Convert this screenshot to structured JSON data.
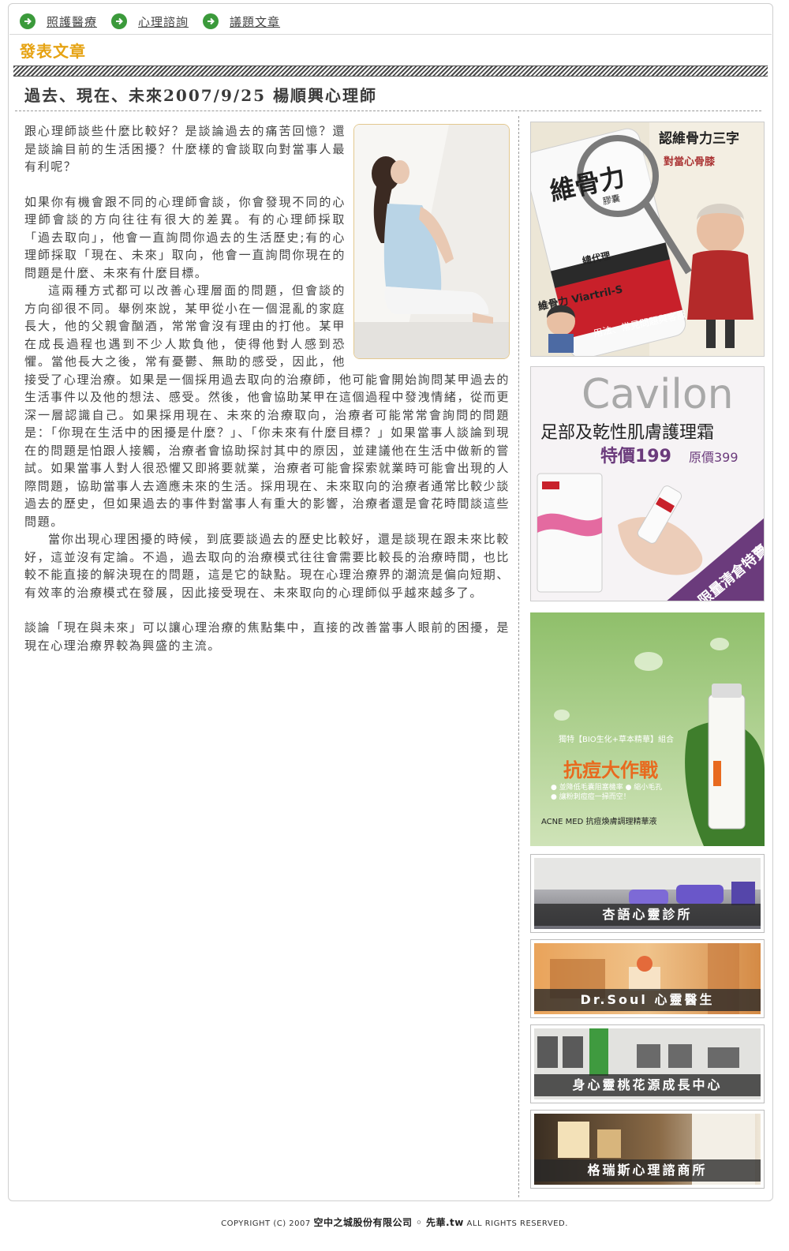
{
  "nav": {
    "items": [
      {
        "label": "照護醫療"
      },
      {
        "label": "心理諮詢"
      },
      {
        "label": "議題文章"
      }
    ]
  },
  "section": {
    "title": "發表文章"
  },
  "article": {
    "title": "過去、現在、未來2007/9/25  楊順興心理師",
    "paragraphs": [
      "跟心理師談些什麼比較好？是談論過去的痛苦回憶？還是談論目前的生活困擾？什麼樣的會談取向對當事人最有利呢？",
      "如果你有機會跟不同的心理師會談，你會發現不同的心理師會談的方向往往有很大的差異。有的心理師採取「過去取向」，他會一直詢問你過去的生活歷史;有的心理師採取「現在、未來」取向，他會一直詢問你現在的問題是什麼、未來有什麼目標。",
      "這兩種方式都可以改善心理層面的問題，但會談的方向卻很不同。舉例來說，某甲從小在一個混亂的家庭長大，他的父親會酗酒，常常會沒有理由的打他。某甲在成長過程也遇到不少人欺負他，使得他對人感到恐懼。當他長大之後，常有憂鬱、無助的感受，因此，他接受了心理治療。如果是一個採用過去取向的治療師，他可能會開始詢問某甲過去的生活事件以及他的想法、感受。然後，他會協助某甲在這個過程中發洩情緒，從而更深一層認識自己。如果採用現在、未來的治療取向，治療者可能常常會詢問的問題是：「你現在生活中的困擾是什麼？」、「你未來有什麼目標？」如果當事人談論到現在的問題是怕跟人接觸，治療者會協助探討其中的原因，並建議他在生活中做新的嘗試。如果當事人對人很恐懼又即將要就業，治療者可能會探索就業時可能會出現的人際問題，協助當事人去適應未來的生活。採用現在、未來取向的治療者通常比較少談過去的歷史，但如果過去的事件對當事人有重大的影響，治療者還是會花時間談這些問題。",
      "當你出現心理困擾的時候，到底要談過去的歷史比較好，還是談現在跟未來比較好，這並沒有定論。不過，過去取向的治療模式往往會需要比較長的治療時間，也比較不能直接的解決現在的問題，這是它的缺點。現在心理治療界的潮流是偏向短期、有效率的治療模式在發展，因此接受現在、未來取向的心理師似乎越來越多了。",
      "談論「現在與未來」可以讓心理治療的焦點集中，直接的改善當事人眼前的困擾，是現在心理治療界較為興盛的主流。"
    ]
  },
  "ads": {
    "ad1": {
      "brand": "維骨力",
      "brand_suffix": "膠囊",
      "side_title": "認維骨力三字",
      "side_sub": "對當心骨膝",
      "label_mid": "總代理",
      "product": "維骨力 Viartril-S",
      "ribbon": "用法、常見問題與客服"
    },
    "ad2": {
      "brand": "Cavilon",
      "title": "足部及乾性肌膚護理霜",
      "price": "特價199",
      "original": "原價399",
      "badge": "限量清倉特賣"
    },
    "ad3": {
      "tagline": "獨特【BIO生化+草本精華】組合",
      "headline": "抗痘大作戰",
      "bullet1": "● 並降低毛囊阻塞機率   ● 縮小毛孔",
      "bullet2": "● 讓粉刺痘痘一掃而空！",
      "product": "ACNE MED 抗痘煥膚調理精華液"
    },
    "clinics": [
      {
        "label": "杏語心靈診所"
      },
      {
        "label": "Dr.Soul 心靈醫生"
      },
      {
        "label": "身心靈桃花源成長中心"
      },
      {
        "label": "格瑞斯心理諮商所"
      }
    ]
  },
  "footer": {
    "prefix": "COPYRIGHT (C) 2007 ",
    "company": "空中之城股份有限公司 ◦ 先華.tw",
    "suffix": " ALL RIGHTS RESERVED."
  },
  "colors": {
    "accent": "#e6a313",
    "nav_icon": "#3b9a3b",
    "ad2_purple": "#6b3b7c"
  }
}
